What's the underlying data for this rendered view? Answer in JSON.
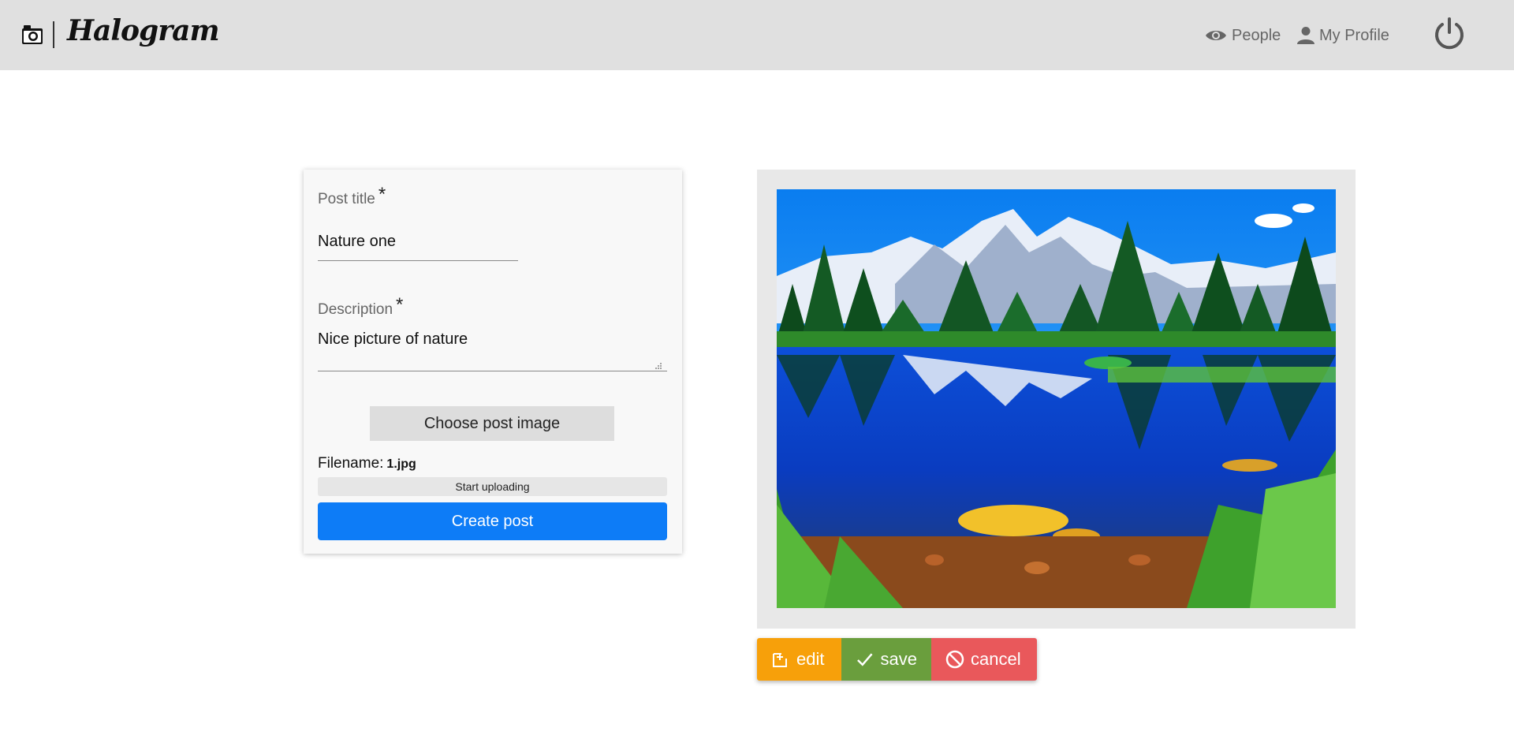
{
  "navbar": {
    "brand": "Halogram",
    "links": [
      {
        "label": "People",
        "icon": "eye-icon"
      },
      {
        "label": "My Profile",
        "icon": "person-icon"
      }
    ],
    "power_icon": "power-icon"
  },
  "form": {
    "title_label": "Post title",
    "title_required": "*",
    "title_value": "Nature one",
    "description_label": "Description",
    "description_required": "*",
    "description_value": "Nice picture of nature",
    "choose_button": "Choose post image",
    "filename_label": "Filename:",
    "filename_value": "1.jpg",
    "upload_text": "Start uploading",
    "upload_progress": 0,
    "create_button": "Create post"
  },
  "image_actions": {
    "edit": "edit",
    "save": "save",
    "cancel": "cancel"
  },
  "colors": {
    "navbar": "#e0e0e0",
    "primary": "#0d7cf7",
    "edit": "#f7a00a",
    "save": "#6a9e3d",
    "cancel": "#e9585b"
  }
}
